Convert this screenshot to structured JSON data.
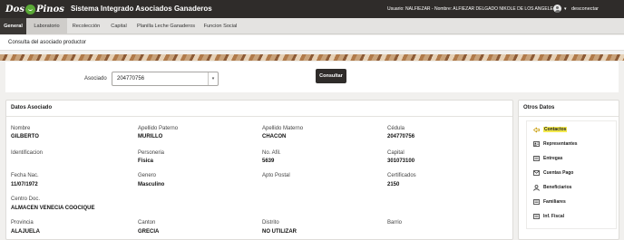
{
  "header": {
    "logo_text_left": "Dos",
    "logo_text_right": "Pinos",
    "app_title": "Sistema Integrado Asociados Ganaderos",
    "user_info": "Usuario: NALFIEZAR - Nombre: ALFIEZAR DELGADO NIKOLE DE LOS ANGELE",
    "logout_label": "desconectar"
  },
  "nav": {
    "items": [
      "General",
      "Laboratorio",
      "Recolección",
      "Capital",
      "Planilla Leche Ganaderos",
      "Funcion Social"
    ],
    "active": "General"
  },
  "page_title": "Consulta del asociado productor",
  "search": {
    "label": "Asociado",
    "value": "204770756",
    "button_label": "Consultar"
  },
  "datos": {
    "title": "Datos Asociado",
    "fields": [
      {
        "label": "Nombre",
        "value": "GILBERTO"
      },
      {
        "label": "Apellido Paterno",
        "value": "MURILLO"
      },
      {
        "label": "Apellido Materno",
        "value": "CHACON"
      },
      {
        "label": "Cédula",
        "value": "204770756"
      },
      {
        "label": "Identificacion",
        "value": ""
      },
      {
        "label": "Personeria",
        "value": "Fisica"
      },
      {
        "label": "No. Afil.",
        "value": "5639"
      },
      {
        "label": "Capital",
        "value": "301073100"
      },
      {
        "label": "Fecha Nac.",
        "value": "11/07/1972"
      },
      {
        "label": "Genero",
        "value": "Masculino"
      },
      {
        "label": "Apto Postal",
        "value": ""
      },
      {
        "label": "Certificados",
        "value": "2150"
      },
      {
        "label": "Centro Doc.",
        "value": "ALMACEN VENECIA COOCIQUE"
      },
      {
        "label": "Provincia",
        "value": "ALAJUELA"
      },
      {
        "label": "Canton",
        "value": "GRECIA"
      },
      {
        "label": "Distrito",
        "value": "NO UTILIZAR"
      },
      {
        "label": "Barrio",
        "value": ""
      }
    ]
  },
  "otros": {
    "title": "Otros Datos",
    "items": [
      {
        "label": "Contactos",
        "icon": "arrow-icon",
        "highlighted": true
      },
      {
        "label": "Representantes",
        "icon": "person-card-icon",
        "highlighted": false
      },
      {
        "label": "Entregas",
        "icon": "document-icon",
        "highlighted": false
      },
      {
        "label": "Cuentas Pago",
        "icon": "envelope-icon",
        "highlighted": false
      },
      {
        "label": "Beneficiarios",
        "icon": "person-icon",
        "highlighted": false
      },
      {
        "label": "Familiares",
        "icon": "document-icon",
        "highlighted": false
      },
      {
        "label": "Inf. Fiscal",
        "icon": "document-icon",
        "highlighted": false
      }
    ],
    "highlight_color": "#f3e94d"
  }
}
